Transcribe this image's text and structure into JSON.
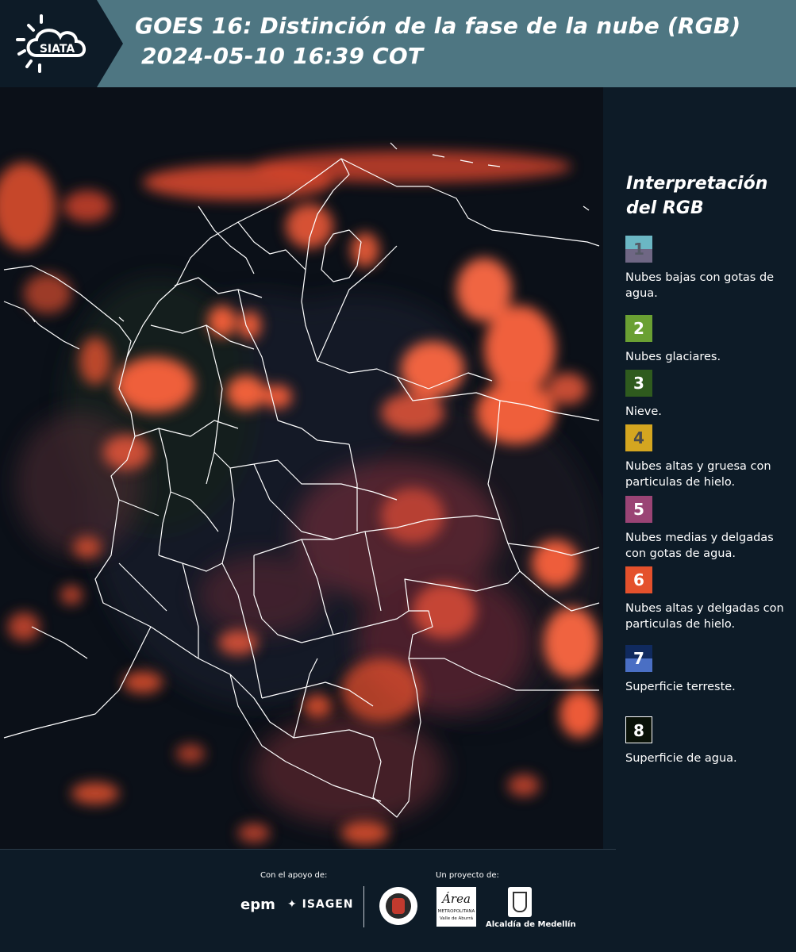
{
  "header": {
    "logo_text": "SIATA",
    "title_line1": "GOES 16: Distinción de la fase de la nube (RGB)",
    "title_line2": "2024-05-10 16:39 COT"
  },
  "map": {
    "image_type": "satellite-rgb-cloud-phase",
    "region": "Colombia",
    "border_color": "#ffffff"
  },
  "legend": {
    "title": "Interpretación del RGB",
    "items": [
      {
        "number": "1",
        "label": "Nubes bajas con gotas de agua.",
        "color_top": "#6bb7c4",
        "color_bottom": "#6f6784",
        "number_color": "#555a66"
      },
      {
        "number": "2",
        "label": "Nubes glaciares.",
        "color": "#6aa033",
        "number_color": "#ffffff"
      },
      {
        "number": "3",
        "label": "Nieve.",
        "color": "#2f5b1e",
        "number_color": "#ffffff"
      },
      {
        "number": "4",
        "label": "Nubes altas y gruesa con particulas de hielo.",
        "color": "#d4a620",
        "number_color": "#4a4a4a"
      },
      {
        "number": "5",
        "label": "Nubes medias y delgadas con gotas de agua.",
        "color": "#9a4475",
        "number_color": "#ffffff"
      },
      {
        "number": "6",
        "label": "Nubes altas y delgadas con particulas de hielo.",
        "color": "#e4512c",
        "number_color": "#ffffff"
      },
      {
        "number": "7",
        "label": "Superficie terreste.",
        "color_top": "#102a5e",
        "color_bottom": "#4a6fc4",
        "number_color": "#ffffff"
      },
      {
        "number": "8",
        "label": "Superficie de agua.",
        "color": "#0a1208",
        "number_color": "#ffffff",
        "border": "#ffffff"
      }
    ]
  },
  "footer": {
    "support_label": "Con el apoyo de:",
    "project_label": "Un proyecto de:",
    "sponsors": [
      "epm",
      "ISAGEN"
    ],
    "partners": [
      "Área Metropolitana Valle de Aburrá",
      "Alcaldía de Medellín"
    ],
    "epm_text": "epm",
    "isagen_text": "ISAGEN",
    "area_text": "Área",
    "area_sub": "METROPOLITANA",
    "area_sub2": "Valle de Aburrá",
    "alcaldia_text": "Alcaldía de Medellín"
  }
}
